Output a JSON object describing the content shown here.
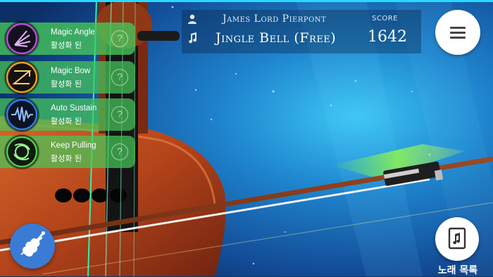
{
  "header": {
    "composer": "James Lord Pierpont",
    "song_title": "Jingle Bell (Free)",
    "score_label": "SCORE",
    "score_value": "1642"
  },
  "abilities": [
    {
      "title": "Magic Angle",
      "status": "활성화 된",
      "icon": "magic-angle-icon",
      "color": "#c04bd6"
    },
    {
      "title": "Magic Bow",
      "status": "활성화 된",
      "icon": "magic-bow-icon",
      "color": "#f0a020"
    },
    {
      "title": "Auto Sustain",
      "status": "활성화 된",
      "icon": "auto-sustain-icon",
      "color": "#2f7df0"
    },
    {
      "title": "Keep Pulling",
      "status": "활성화 된",
      "icon": "keep-pulling-icon",
      "color": "#4fd04a"
    }
  ],
  "help_glyph": "?",
  "song_list_label": "노래 목록",
  "colors": {
    "accent_green": "#46c85a",
    "fab_blue": "#3a7bd5",
    "sky_top": "#1e4f96",
    "violin_wood": "#b5441c"
  }
}
